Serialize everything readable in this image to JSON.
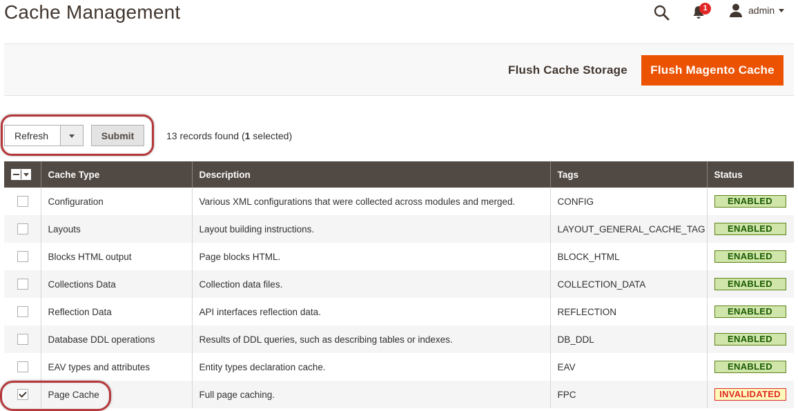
{
  "page": {
    "title": "Cache Management"
  },
  "header": {
    "notifications_count": "1",
    "user_name": "admin"
  },
  "actions": {
    "flush_storage_label": "Flush Cache Storage",
    "flush_magento_label": "Flush Magento Cache"
  },
  "mass_action": {
    "selected_action": "Refresh",
    "submit_label": "Submit",
    "records_prefix": "13 records found (",
    "selected_count": "1",
    "records_suffix": " selected)"
  },
  "grid": {
    "columns": [
      "Cache Type",
      "Description",
      "Tags",
      "Status"
    ],
    "rows": [
      {
        "checked": false,
        "type": "Configuration",
        "description": "Various XML configurations that were collected across modules and merged.",
        "tags": "CONFIG",
        "status": "ENABLED"
      },
      {
        "checked": false,
        "type": "Layouts",
        "description": "Layout building instructions.",
        "tags": "LAYOUT_GENERAL_CACHE_TAG",
        "status": "ENABLED"
      },
      {
        "checked": false,
        "type": "Blocks HTML output",
        "description": "Page blocks HTML.",
        "tags": "BLOCK_HTML",
        "status": "ENABLED"
      },
      {
        "checked": false,
        "type": "Collections Data",
        "description": "Collection data files.",
        "tags": "COLLECTION_DATA",
        "status": "ENABLED"
      },
      {
        "checked": false,
        "type": "Reflection Data",
        "description": "API interfaces reflection data.",
        "tags": "REFLECTION",
        "status": "ENABLED"
      },
      {
        "checked": false,
        "type": "Database DDL operations",
        "description": "Results of DDL queries, such as describing tables or indexes.",
        "tags": "DB_DDL",
        "status": "ENABLED"
      },
      {
        "checked": false,
        "type": "EAV types and attributes",
        "description": "Entity types declaration cache.",
        "tags": "EAV",
        "status": "ENABLED"
      },
      {
        "checked": true,
        "type": "Page Cache",
        "description": "Full page caching.",
        "tags": "FPC",
        "status": "INVALIDATED"
      }
    ]
  },
  "colors": {
    "accent": "#eb5202",
    "header_bg": "#514943",
    "enabled": "#d0e5a9",
    "invalidated": "#e22626",
    "highlight": "#b5373a"
  }
}
